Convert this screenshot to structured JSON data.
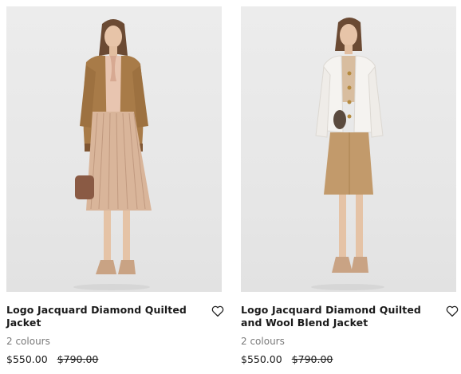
{
  "products": [
    {
      "title": "Logo Jacquard Diamond Quilted Jacket",
      "colours": "2 colours",
      "price": "$550.00",
      "original_price": "$790.00",
      "image_alt": "Model wearing camel quilted jacket with pleated skirt",
      "wishlist_icon": "heart-icon"
    },
    {
      "title": "Logo Jacquard Diamond Quilted and Wool Blend Jacket",
      "colours": "2 colours",
      "price": "$550.00",
      "original_price": "$790.00",
      "image_alt": "Model wearing white quilted jacket with camel skirt",
      "wishlist_icon": "heart-icon"
    }
  ],
  "colors": {
    "photo_bg": "#e8e8e8",
    "jacket_1": "#a87b48",
    "jacket_2": "#f5f3f0",
    "skirt_1": "#d9b59a",
    "skirt_2": "#c29a6b"
  }
}
